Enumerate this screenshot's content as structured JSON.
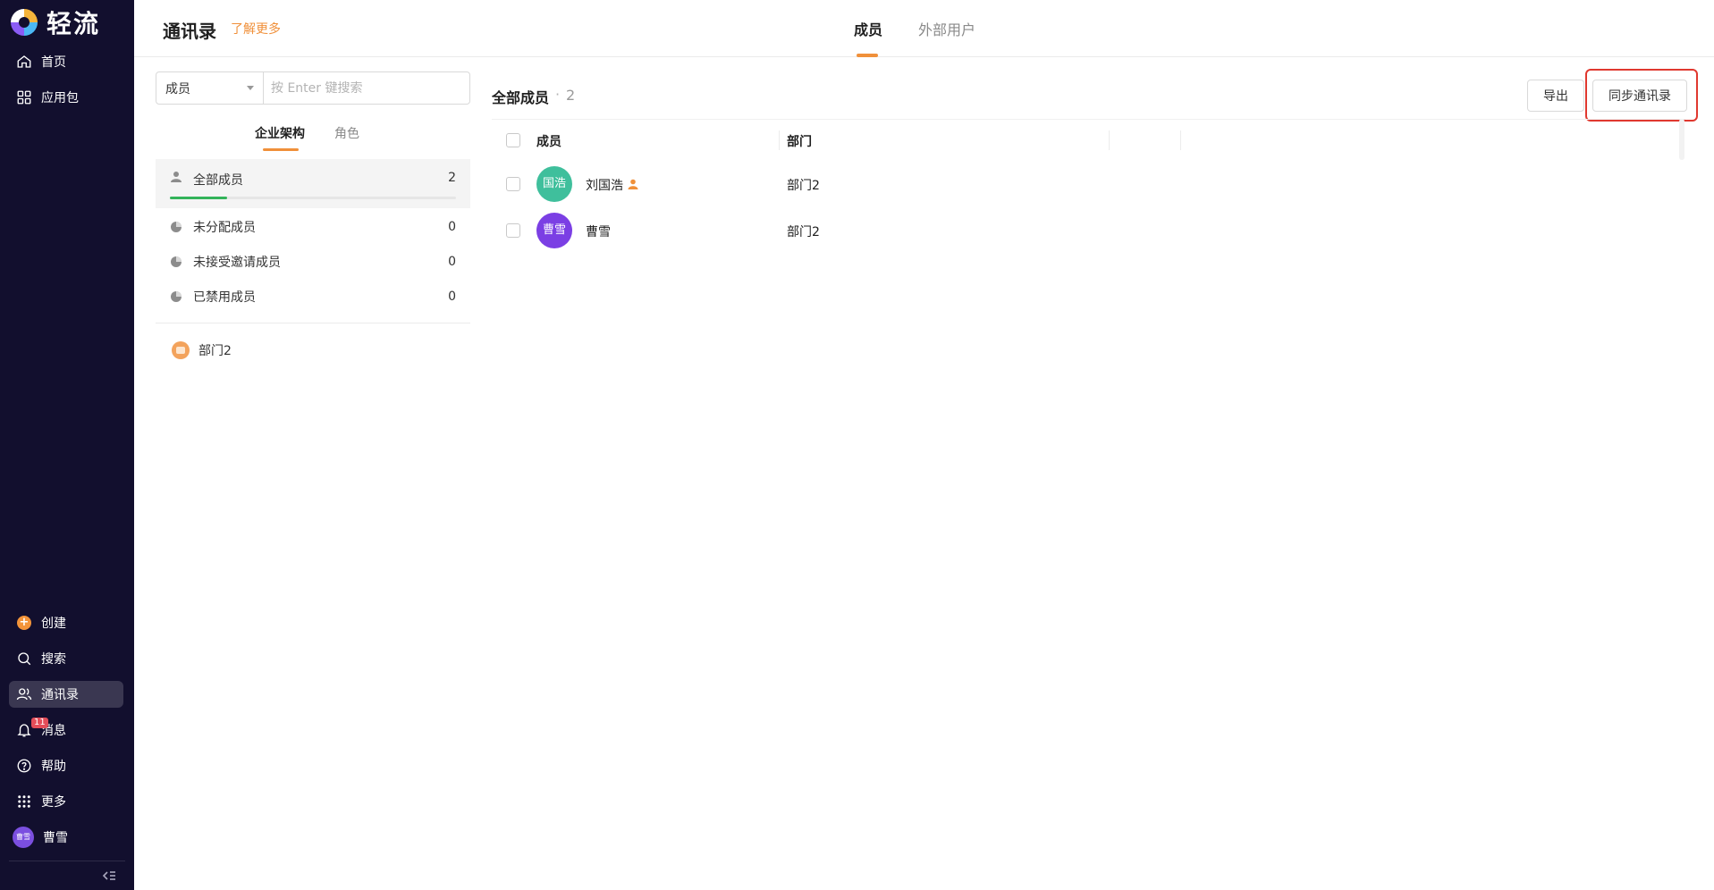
{
  "app": {
    "brand": "轻流"
  },
  "sidebar": {
    "top_items": [
      {
        "label": "首页",
        "icon": "home-icon"
      },
      {
        "label": "应用包",
        "icon": "grid-icon"
      }
    ],
    "bottom_items": [
      {
        "label": "创建",
        "icon": "plus-circle-icon"
      },
      {
        "label": "搜索",
        "icon": "search-icon"
      },
      {
        "label": "通讯录",
        "icon": "contacts-icon",
        "active": true
      },
      {
        "label": "消息",
        "icon": "bell-icon",
        "badge": "11"
      },
      {
        "label": "帮助",
        "icon": "help-icon"
      },
      {
        "label": "更多",
        "icon": "dots-grid-icon"
      },
      {
        "label": "曹雪",
        "icon": "avatar",
        "avatar_text": "曹雪"
      }
    ]
  },
  "header": {
    "title": "通讯录",
    "learn_more": "了解更多",
    "tabs": [
      {
        "label": "成员",
        "active": true
      },
      {
        "label": "外部用户",
        "active": false
      }
    ]
  },
  "filter": {
    "select_value": "成员",
    "search_placeholder": "按 Enter 键搜索"
  },
  "subtabs": [
    {
      "label": "企业架构",
      "active": true
    },
    {
      "label": "角色",
      "active": false
    }
  ],
  "groups": [
    {
      "label": "全部成员",
      "count": "2",
      "selected": true,
      "progress": 0.2
    },
    {
      "label": "未分配成员",
      "count": "0"
    },
    {
      "label": "未接受邀请成员",
      "count": "0"
    },
    {
      "label": "已禁用成员",
      "count": "0"
    }
  ],
  "departments": [
    {
      "label": "部门2"
    }
  ],
  "members_panel": {
    "title": "全部成员",
    "separator": "·",
    "count": "2",
    "export_label": "导出",
    "sync_label": "同步通讯录",
    "columns": [
      "成员",
      "部门"
    ],
    "rows": [
      {
        "avatar_text": "国浩",
        "avatar_color": "#3fbf9c",
        "name": "刘国浩",
        "admin": true,
        "department": "部门2"
      },
      {
        "avatar_text": "曹雪",
        "avatar_color": "#7b3fe4",
        "name": "曹雪",
        "admin": false,
        "department": "部门2"
      }
    ]
  },
  "colors": {
    "sidebar_bg": "#120f2e",
    "accent": "#f0903a",
    "progress": "#33b35a",
    "highlight": "#e0382f"
  }
}
